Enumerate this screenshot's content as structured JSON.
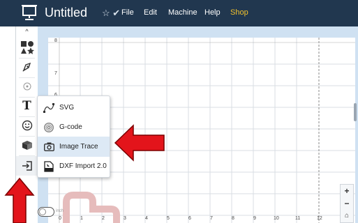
{
  "header": {
    "title": "Untitled",
    "title_icons": "☆ ✔",
    "menu": [
      "File",
      "Edit",
      "Machine",
      "Help",
      "Shop"
    ]
  },
  "toolbar": {
    "tools": [
      "shapes-icon",
      "pen-icon",
      "target-icon",
      "text-icon",
      "emoji-icon",
      "box-icon",
      "import-icon"
    ],
    "text_tool_label": "T"
  },
  "import_menu": {
    "items": [
      {
        "label": "SVG",
        "icon": "svg-curve-icon"
      },
      {
        "label": "G-code",
        "icon": "gcode-icon"
      },
      {
        "label": "Image Trace",
        "icon": "camera-icon"
      },
      {
        "label": "DXF Import 2.0",
        "icon": "dxf-file-icon"
      }
    ],
    "highlighted_index": 2
  },
  "canvas": {
    "x_ticks": [
      "0",
      "1",
      "2",
      "3",
      "4",
      "5",
      "6",
      "7",
      "8",
      "9",
      "10",
      "11",
      "12"
    ],
    "y_ticks": [
      "8",
      "7",
      "6"
    ],
    "units_label": "inch"
  },
  "zoom": {
    "in": "+",
    "out": "−",
    "home": "⌂"
  },
  "colors": {
    "topbar": "#21374f",
    "shop": "#f2c22d",
    "canvas_bg": "#cfe1f2",
    "arrow": "#e3141b",
    "highlight": "#dde9f5"
  }
}
